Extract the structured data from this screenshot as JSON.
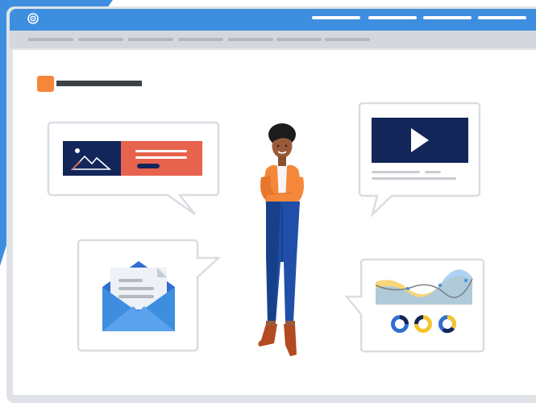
{
  "browser": {
    "nav_items": 4,
    "tabs": 7
  },
  "colors": {
    "accent_blue": "#3e8ee0",
    "navy": "#13265a",
    "orange": "#f5873a",
    "coral": "#e8634e",
    "yellow": "#f5c42c"
  },
  "icons": [
    "logo-icon",
    "image-icon",
    "play-icon",
    "envelope-icon",
    "wave-chart-icon",
    "donut-chart-icon"
  ]
}
